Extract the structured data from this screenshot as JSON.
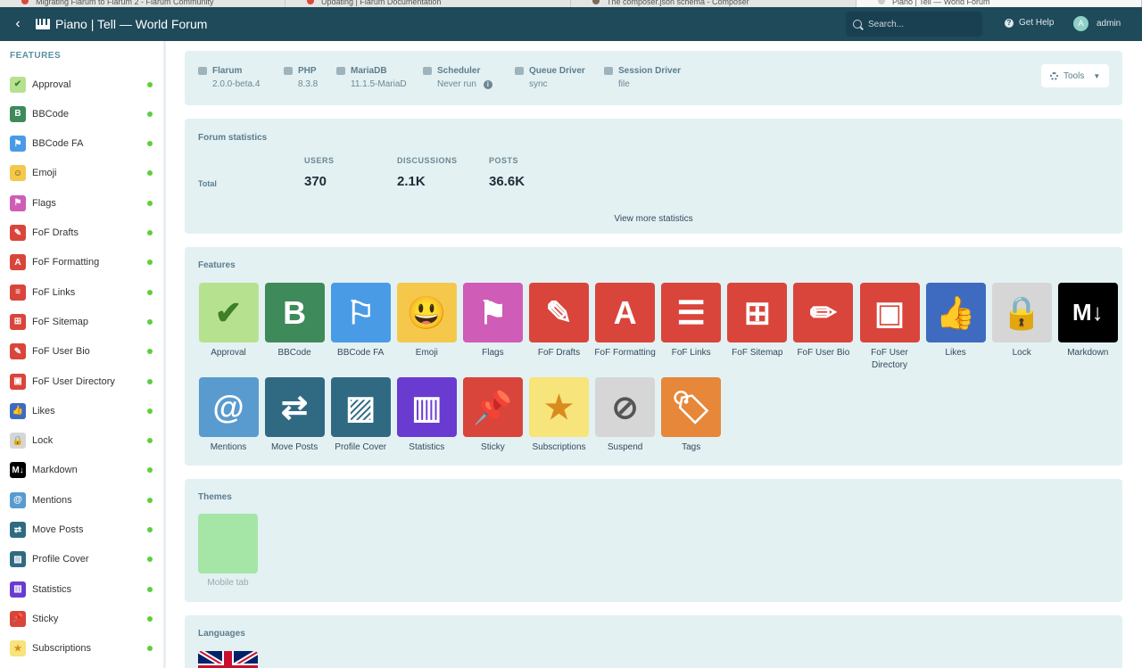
{
  "browser_tabs": [
    {
      "title": "Migrating Flarum to Flarum 2 - Flarum Community",
      "dot": "#d94a38"
    },
    {
      "title": "Updating | Flarum Documentation",
      "dot": "#d94a38"
    },
    {
      "title": "The composer.json schema - Composer",
      "dot": "#7a6a5a"
    },
    {
      "title": "Piano | Tell — World Forum",
      "dot": "#cccccc"
    }
  ],
  "header": {
    "title": "Piano | Tell — World Forum",
    "search_placeholder": "Search...",
    "help_label": "Get Help",
    "user_initial": "A",
    "user_name": "admin"
  },
  "sidebar": {
    "heading": "FEATURES",
    "items": [
      {
        "label": "Approval",
        "color": "#b6e290",
        "glyph": "✔",
        "fg": "#3f7f2a"
      },
      {
        "label": "BBCode",
        "color": "#3e8a5a",
        "glyph": "B",
        "fg": "#ffffff"
      },
      {
        "label": "BBCode FA",
        "color": "#4a9be6",
        "glyph": "⚑",
        "fg": "#ffffff"
      },
      {
        "label": "Emoji",
        "color": "#f5c84c",
        "glyph": "☺",
        "fg": "#5a4000"
      },
      {
        "label": "Flags",
        "color": "#cf5cb6",
        "glyph": "⚑",
        "fg": "#ffffff"
      },
      {
        "label": "FoF Drafts",
        "color": "#d9453b",
        "glyph": "✎",
        "fg": "#ffffff"
      },
      {
        "label": "FoF Formatting",
        "color": "#d9453b",
        "glyph": "A",
        "fg": "#ffffff"
      },
      {
        "label": "FoF Links",
        "color": "#d9453b",
        "glyph": "≡",
        "fg": "#ffffff"
      },
      {
        "label": "FoF Sitemap",
        "color": "#d9453b",
        "glyph": "⊞",
        "fg": "#ffffff"
      },
      {
        "label": "FoF User Bio",
        "color": "#d9453b",
        "glyph": "✎",
        "fg": "#ffffff"
      },
      {
        "label": "FoF User Directory",
        "color": "#d9453b",
        "glyph": "▣",
        "fg": "#ffffff"
      },
      {
        "label": "Likes",
        "color": "#3e6bc0",
        "glyph": "👍",
        "fg": "#ffffff"
      },
      {
        "label": "Lock",
        "color": "#d6d6d6",
        "glyph": "🔒",
        "fg": "#555555"
      },
      {
        "label": "Markdown",
        "color": "#000000",
        "glyph": "M↓",
        "fg": "#ffffff"
      },
      {
        "label": "Mentions",
        "color": "#5a9bcf",
        "glyph": "@",
        "fg": "#ffffff"
      },
      {
        "label": "Move Posts",
        "color": "#306a82",
        "glyph": "⇄",
        "fg": "#ffffff"
      },
      {
        "label": "Profile Cover",
        "color": "#306a82",
        "glyph": "▨",
        "fg": "#ffffff"
      },
      {
        "label": "Statistics",
        "color": "#6a3bd1",
        "glyph": "▥",
        "fg": "#ffffff"
      },
      {
        "label": "Sticky",
        "color": "#d9453b",
        "glyph": "📌",
        "fg": "#ffffff"
      },
      {
        "label": "Subscriptions",
        "color": "#f7e47a",
        "glyph": "★",
        "fg": "#d98b1e"
      }
    ]
  },
  "status": {
    "items": [
      {
        "title": "Flarum",
        "value": "2.0.0-beta.4"
      },
      {
        "title": "PHP",
        "value": "8.3.8"
      },
      {
        "title": "MariaDB",
        "value": "11.1.5-MariaD"
      },
      {
        "title": "Scheduler",
        "value": "Never run"
      },
      {
        "title": "Queue Driver",
        "value": "sync"
      },
      {
        "title": "Session Driver",
        "value": "file"
      }
    ],
    "tools_label": "Tools"
  },
  "forum_stats": {
    "title": "Forum statistics",
    "row_label": "Total",
    "columns": [
      {
        "heading": "USERS",
        "value": "370"
      },
      {
        "heading": "DISCUSSIONS",
        "value": "2.1K"
      },
      {
        "heading": "POSTS",
        "value": "36.6K"
      }
    ],
    "more_label": "View more statistics"
  },
  "features": {
    "title": "Features",
    "tiles": [
      {
        "label": "Approval",
        "color": "#b6e290",
        "glyph": "✔",
        "fg": "#3f7f2a"
      },
      {
        "label": "BBCode",
        "color": "#3e8a5a",
        "glyph": "B",
        "fg": "#ffffff"
      },
      {
        "label": "BBCode FA",
        "color": "#4a9be6",
        "glyph": "⚐",
        "fg": "#ffffff"
      },
      {
        "label": "Emoji",
        "color": "#f5c84c",
        "glyph": "😃",
        "fg": "#3a2a00"
      },
      {
        "label": "Flags",
        "color": "#cf5cb6",
        "glyph": "⚑",
        "fg": "#ffffff"
      },
      {
        "label": "FoF Drafts",
        "color": "#d9453b",
        "glyph": "✎",
        "fg": "#ffffff"
      },
      {
        "label": "FoF Formatting",
        "color": "#d9453b",
        "glyph": "A",
        "fg": "#ffffff"
      },
      {
        "label": "FoF Links",
        "color": "#d9453b",
        "glyph": "☰",
        "fg": "#ffffff"
      },
      {
        "label": "FoF Sitemap",
        "color": "#d9453b",
        "glyph": "⊞",
        "fg": "#ffffff"
      },
      {
        "label": "FoF User Bio",
        "color": "#d9453b",
        "glyph": "✏",
        "fg": "#ffffff"
      },
      {
        "label": "FoF User Directory",
        "color": "#d9453b",
        "glyph": "▣",
        "fg": "#ffffff"
      },
      {
        "label": "Likes",
        "color": "#3e6bc0",
        "glyph": "👍",
        "fg": "#ffffff"
      },
      {
        "label": "Lock",
        "color": "#d6d6d6",
        "glyph": "🔒",
        "fg": "#555555"
      },
      {
        "label": "Markdown",
        "color": "#000000",
        "glyph": "M↓",
        "fg": "#ffffff"
      },
      {
        "label": "Mentions",
        "color": "#5a9bcf",
        "glyph": "@",
        "fg": "#ffffff"
      },
      {
        "label": "Move Posts",
        "color": "#306a82",
        "glyph": "⇄",
        "fg": "#ffffff"
      },
      {
        "label": "Profile Cover",
        "color": "#306a82",
        "glyph": "▨",
        "fg": "#ffffff"
      },
      {
        "label": "Statistics",
        "color": "#6a3bd1",
        "glyph": "▥",
        "fg": "#ffffff"
      },
      {
        "label": "Sticky",
        "color": "#d9453b",
        "glyph": "📌",
        "fg": "#ffffff"
      },
      {
        "label": "Subscriptions",
        "color": "#f7e47a",
        "glyph": "★",
        "fg": "#d98b1e"
      },
      {
        "label": "Suspend",
        "color": "#d6d6d6",
        "glyph": "⊘",
        "fg": "#555555"
      },
      {
        "label": "Tags",
        "color": "#e6873a",
        "glyph": "🏷",
        "fg": "#ffffff"
      }
    ]
  },
  "themes": {
    "title": "Themes",
    "tile_label": "Mobile tab",
    "tile_color": "#a5e6a6"
  },
  "languages": {
    "title": "Languages"
  }
}
